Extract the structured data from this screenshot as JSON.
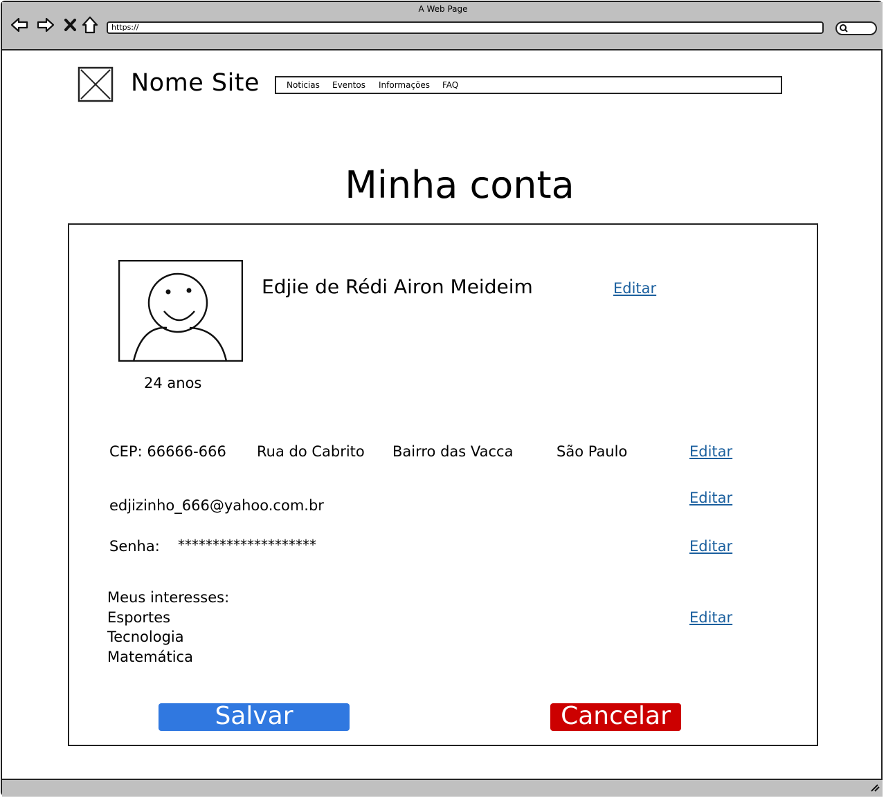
{
  "browser": {
    "window_title": "A Web Page",
    "url": "https://"
  },
  "header": {
    "site_name": "Nome Site",
    "menu": [
      "Noticias",
      "Eventos",
      "Informações",
      "FAQ"
    ]
  },
  "page": {
    "title": "Minha conta"
  },
  "profile": {
    "name": "Edjie de Rédi Airon Meideim",
    "age": "24 anos",
    "edit_label": "Editar"
  },
  "address": {
    "cep": "CEP: 66666-666",
    "street": "Rua do Cabrito",
    "district": "Bairro das Vacca",
    "city": "São Paulo",
    "edit_label": "Editar"
  },
  "email": {
    "value": "edjizinho_666@yahoo.com.br",
    "edit_label": "Editar"
  },
  "password": {
    "label": "Senha:",
    "value": "********************",
    "edit_label": "Editar"
  },
  "interests": {
    "heading": "Meus interesses:",
    "items": [
      "Esportes",
      "Tecnologia",
      "Matemática"
    ],
    "edit_label": "Editar"
  },
  "actions": {
    "save_label": "Salvar",
    "cancel_label": "Cancelar",
    "save_color": "#3078e0",
    "cancel_color": "#cc0000"
  },
  "icons": [
    "back-icon",
    "forward-icon",
    "close-icon",
    "home-icon",
    "search-icon",
    "image-placeholder-icon",
    "user-avatar-icon",
    "resize-grip-icon"
  ]
}
